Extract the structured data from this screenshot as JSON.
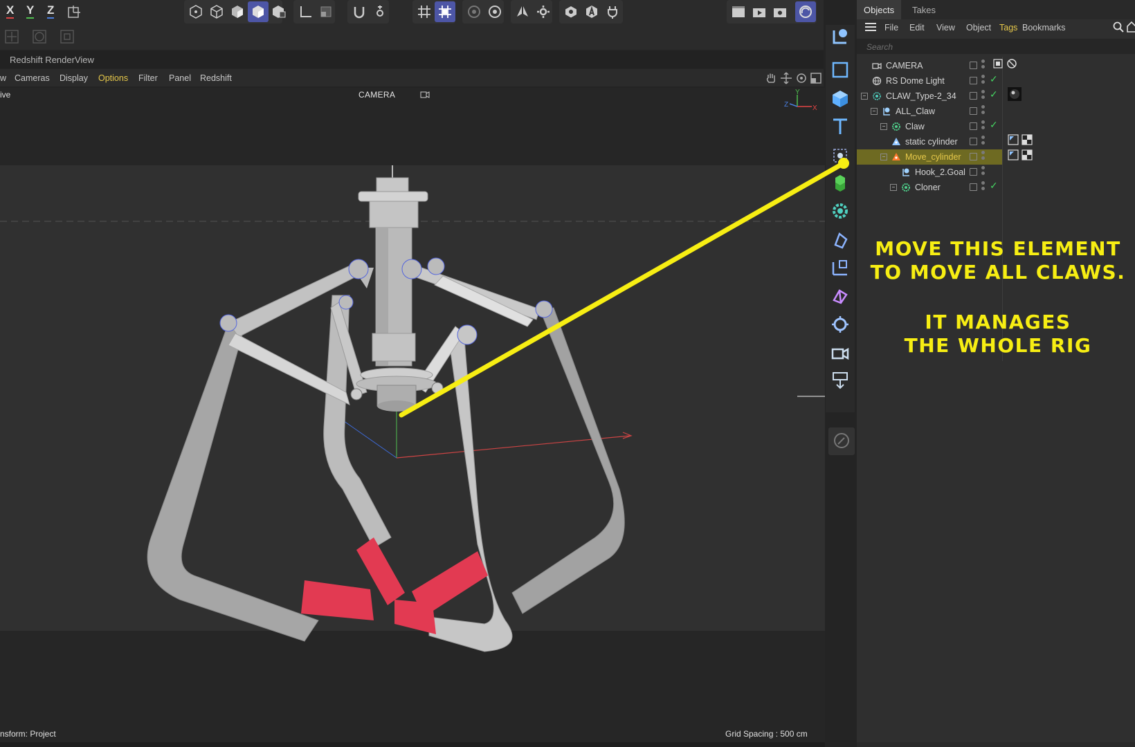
{
  "toolbar": {
    "axis_x": "X",
    "axis_y": "Y",
    "axis_z": "Z",
    "icons": [
      "coordinate-system-icon",
      "points-mode-icon",
      "edges-mode-icon",
      "polygons-mode-icon",
      "model-mode-icon",
      "texture-mode-icon",
      "axis-mode-icon",
      "live-select-icon",
      "snap-icon",
      "snap-settings-icon",
      "grid-icon",
      "workplane-icon",
      "solo-icon",
      "solo-settings-icon",
      "symmetry-icon",
      "symmetry-settings-icon",
      "render-region-icon",
      "redshift-icon",
      "plug-icon",
      "render-view-icon",
      "render-active-icon",
      "render-settings-icon",
      "redshift-render-icon"
    ],
    "row2_icons": [
      "move-icon",
      "rotate-icon",
      "scale-icon"
    ]
  },
  "render_view": {
    "title": "Redshift RenderView"
  },
  "viewport_menu": {
    "items": [
      "w",
      "Cameras",
      "Display",
      "Options",
      "Filter",
      "Panel",
      "Redshift"
    ],
    "highlight": "Options"
  },
  "viewport": {
    "label_left": "ive",
    "camera_label": "CAMERA",
    "status_left": "nsform: Project",
    "grid_spacing": "Grid Spacing : 500 cm",
    "axis_gizmo": {
      "y": "Y",
      "z": "Z",
      "x": "X"
    }
  },
  "object_manager": {
    "tabs": [
      "Objects",
      "Takes"
    ],
    "active_tab": "Objects",
    "menu": [
      "File",
      "Edit",
      "View",
      "Object",
      "Tags",
      "Bookmarks"
    ],
    "menu_highlight": "Tags",
    "search_placeholder": "Search",
    "rows": [
      {
        "name": "CAMERA",
        "check": false
      },
      {
        "name": "RS Dome Light",
        "check": true
      },
      {
        "name": "CLAW_Type-2_34",
        "check": true
      },
      {
        "name": "ALL_Claw",
        "check": false
      },
      {
        "name": "Claw",
        "check": true
      },
      {
        "name": "static cylinder",
        "check": false
      },
      {
        "name": "Move_cylinder",
        "check": false,
        "selected": true
      },
      {
        "name": "Hook_2.Goal",
        "check": false
      },
      {
        "name": "Cloner",
        "check": true
      }
    ],
    "check_glyph": "✓"
  },
  "annotation": {
    "line1": "MOVE THIS ELEMENT",
    "line2": "TO MOVE ALL CLAWS.",
    "line3": "IT MANAGES",
    "line4": "THE WHOLE RIG",
    "color": "#f7ee13"
  },
  "colors": {
    "accent_blue": "#4d56a6",
    "menu_highlight": "#e6c84a",
    "selection_bg": "#6e6a22",
    "check_green": "#45d061",
    "axis_x": "#e04545",
    "axis_y": "#4fbf4f",
    "axis_z": "#4a7fe0"
  }
}
